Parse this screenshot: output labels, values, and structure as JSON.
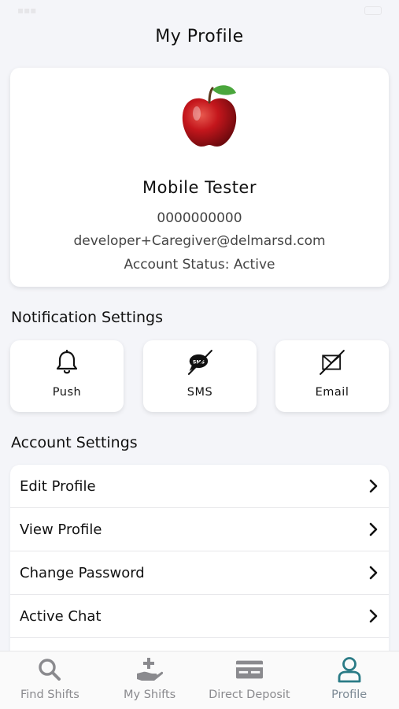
{
  "header": {
    "title": "My Profile"
  },
  "profile": {
    "name": "Mobile Tester",
    "phone": "0000000000",
    "email": "developer+Caregiver@delmarsd.com",
    "status": "Account Status: Active",
    "avatar_icon": "apple-icon"
  },
  "notifications": {
    "heading": "Notification Settings",
    "items": [
      {
        "label": "Push",
        "icon": "bell-icon",
        "enabled": true
      },
      {
        "label": "SMS",
        "icon": "sms-off-icon",
        "enabled": false
      },
      {
        "label": "Email",
        "icon": "email-off-icon",
        "enabled": false
      }
    ]
  },
  "account": {
    "heading": "Account Settings",
    "items": [
      {
        "label": "Edit Profile"
      },
      {
        "label": "View Profile"
      },
      {
        "label": "Change Password"
      },
      {
        "label": "Active Chat"
      }
    ]
  },
  "tabbar": {
    "items": [
      {
        "label": "Find Shifts",
        "icon": "search-icon"
      },
      {
        "label": "My Shifts",
        "icon": "hand-plus-icon"
      },
      {
        "label": "Direct Deposit",
        "icon": "card-icon"
      },
      {
        "label": "Profile",
        "icon": "user-icon",
        "active": true
      }
    ]
  },
  "colors": {
    "background": "#f4f5f9",
    "card": "#ffffff",
    "active_tab_icon": "#2a7b86",
    "inactive_tab": "#8a8a8e"
  }
}
